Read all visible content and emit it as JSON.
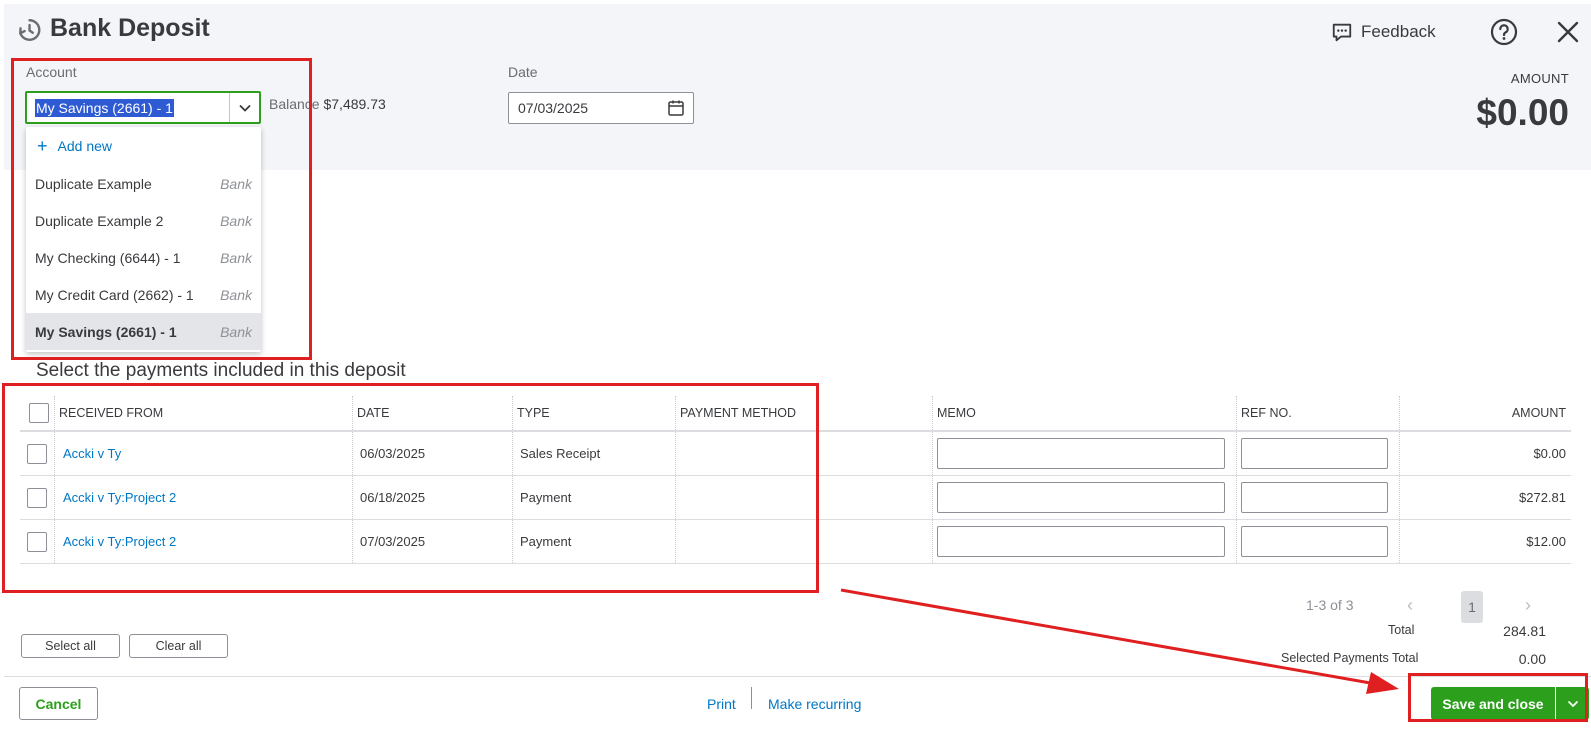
{
  "header": {
    "title": "Bank Deposit",
    "feedback_label": "Feedback"
  },
  "account": {
    "label": "Account",
    "selected": "My Savings (2661) - 1",
    "balance_label": "Balance",
    "balance_value": "$7,489.73"
  },
  "date": {
    "label": "Date",
    "value": "07/03/2025"
  },
  "amount": {
    "label": "AMOUNT",
    "value": "$0.00"
  },
  "dropdown": {
    "add_new": "Add new",
    "items": [
      {
        "name": "Duplicate Example",
        "type": "Bank"
      },
      {
        "name": "Duplicate Example 2",
        "type": "Bank"
      },
      {
        "name": "My Checking (6644) - 1",
        "type": "Bank"
      },
      {
        "name": "My Credit Card (2662) - 1",
        "type": "Bank"
      },
      {
        "name": "My Savings (2661) - 1",
        "type": "Bank"
      }
    ]
  },
  "payments": {
    "title": "Select the payments included in this deposit",
    "columns": [
      "RECEIVED FROM",
      "DATE",
      "TYPE",
      "PAYMENT METHOD",
      "MEMO",
      "REF NO.",
      "AMOUNT"
    ],
    "rows": [
      {
        "received_from": "Accki v Ty",
        "date": "06/03/2025",
        "type": "Sales Receipt",
        "payment_method": "",
        "memo": "",
        "ref_no": "",
        "amount": "$0.00"
      },
      {
        "received_from": "Accki v Ty:Project 2",
        "date": "06/18/2025",
        "type": "Payment",
        "payment_method": "",
        "memo": "",
        "ref_no": "",
        "amount": "$272.81"
      },
      {
        "received_from": "Accki v Ty:Project 2",
        "date": "07/03/2025",
        "type": "Payment",
        "payment_method": "",
        "memo": "",
        "ref_no": "",
        "amount": "$12.00"
      }
    ]
  },
  "pagination": {
    "range": "1-3 of 3",
    "prev": "‹",
    "page": "1",
    "next": "›"
  },
  "actions": {
    "select_all": "Select all",
    "clear_all": "Clear all"
  },
  "totals": {
    "total_label": "Total",
    "total_value": "284.81",
    "selected_label": "Selected Payments Total",
    "selected_value": "0.00"
  },
  "footer": {
    "cancel": "Cancel",
    "print": "Print",
    "make_recurring": "Make recurring",
    "save_and_close": "Save and close"
  },
  "colors": {
    "accent_green": "#2ca01c",
    "link_blue": "#0077c5",
    "annotation_red": "#e02020"
  }
}
